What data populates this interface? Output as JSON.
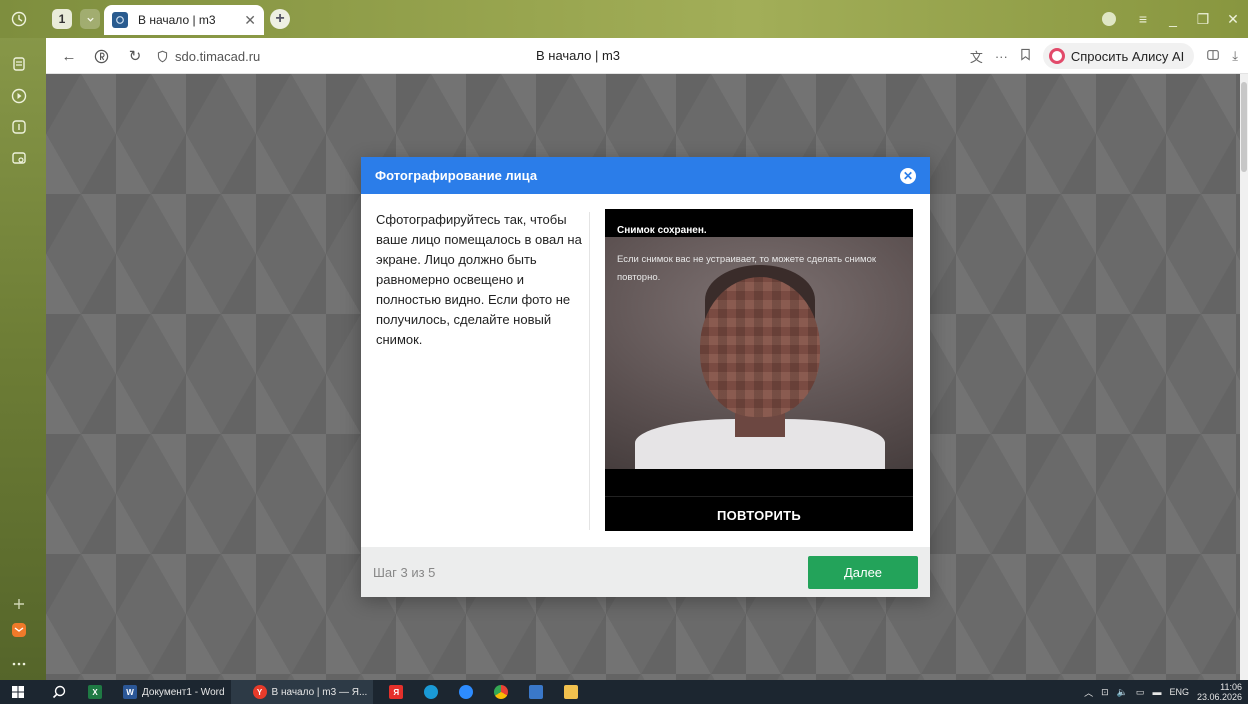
{
  "browser": {
    "tab_counter": "1",
    "tab_title": "В начало | m3",
    "url": "sdo.timacad.ru",
    "page_title": "В начало | m3",
    "alice_label": "Спросить Алису AI"
  },
  "modal": {
    "title": "Фотографирование лица",
    "instructions": "Сфотографируйтесь так, чтобы ваше лицо помещалось в овал на экране. Лицо должно быть равномерно освещено и полностью видно. Если фото не получилось, сделайте новый снимок.",
    "camera_status": "Снимок сохранен.",
    "camera_note": "Если снимок вас не устраивает, то можете сделать снимок повторно.",
    "retake_label": "ПОВТОРИТЬ",
    "step_text": "Шаг 3 из 5",
    "next_label": "Далее"
  },
  "taskbar": {
    "word_label": "Документ1 - Word",
    "browser_label": "В начало | m3 — Я...",
    "lang": "ENG",
    "time": "11:06",
    "date": "23.06.2026"
  },
  "colors": {
    "modal_header": "#2b7de9",
    "next_button": "#23a35a"
  }
}
